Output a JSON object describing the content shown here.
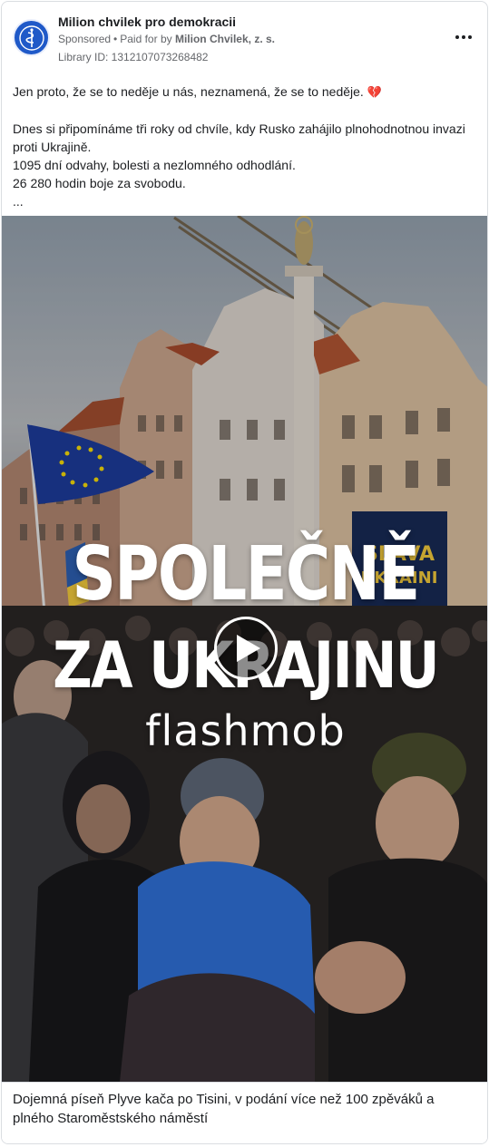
{
  "header": {
    "page_name": "Milion chvilek pro demokracii",
    "sponsored": "Sponsored",
    "separator": "•",
    "paid_for_prefix": "Paid for by",
    "payer": "Milion Chvilek, z. s.",
    "library_id": "Library ID: 1312107073268482",
    "avatar_icon": "milion-chvilek-logo",
    "more_icon": "more-horizontal-icon"
  },
  "post": {
    "line1": "Jen proto, že se to neděje u nás, neznamená, že se to neděje.",
    "line1_emoji": "💔",
    "line2": "Dnes si připomínáme tři roky od chvíle, kdy Rusko zahájilo plnohodnotnou invazi proti Ukrajině.",
    "line3": "1095 dní odvahy, bolesti a nezlomného odhodlání.",
    "line4": "26 280 hodin boje za svobodu.",
    "line5": "..."
  },
  "media": {
    "title_line1": "SPOLEČNĚ",
    "title_line2": "ZA UKRAJINU",
    "subtitle": "flashmob",
    "sign_text_1": "SLAVA",
    "sign_text_2": "UKRAINI",
    "play_icon": "play-icon"
  },
  "caption": {
    "text": "Dojemná píseň Plyve kača po Tisini, v podání více než 100 zpěváků a plného Staroměstského náměstí"
  },
  "colors": {
    "text_primary": "#1c1e21",
    "text_secondary": "#65676b",
    "border": "#dadde1",
    "avatar_bg": "#1f59c8",
    "heart": "#c9184a",
    "eu_flag": "#1d3b9a",
    "eu_star": "#f5d90a",
    "ukraine_blue": "#2d5fb0",
    "ukraine_yellow": "#f1c93b"
  }
}
